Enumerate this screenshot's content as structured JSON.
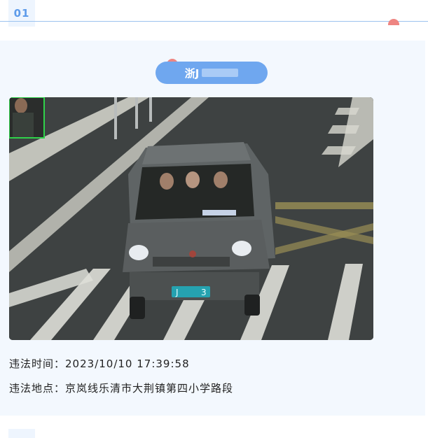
{
  "section_number": "01",
  "plate": {
    "visible_prefix": "浙J"
  },
  "photo": {
    "alt": "违法抓拍照片",
    "rear_plate_text": "J",
    "rear_plate_suffix": "3"
  },
  "violation": {
    "time_label": "违法时间：",
    "time_value": "2023/10/10 17:39:58",
    "location_label": "违法地点：",
    "location_value": "京岚线乐清市大荆镇第四小学路段"
  },
  "colors": {
    "accent": "#6fa7ef",
    "card_bg": "#f3f8fe",
    "badge_text": "#5d9bea",
    "deco": "#ee8582"
  }
}
